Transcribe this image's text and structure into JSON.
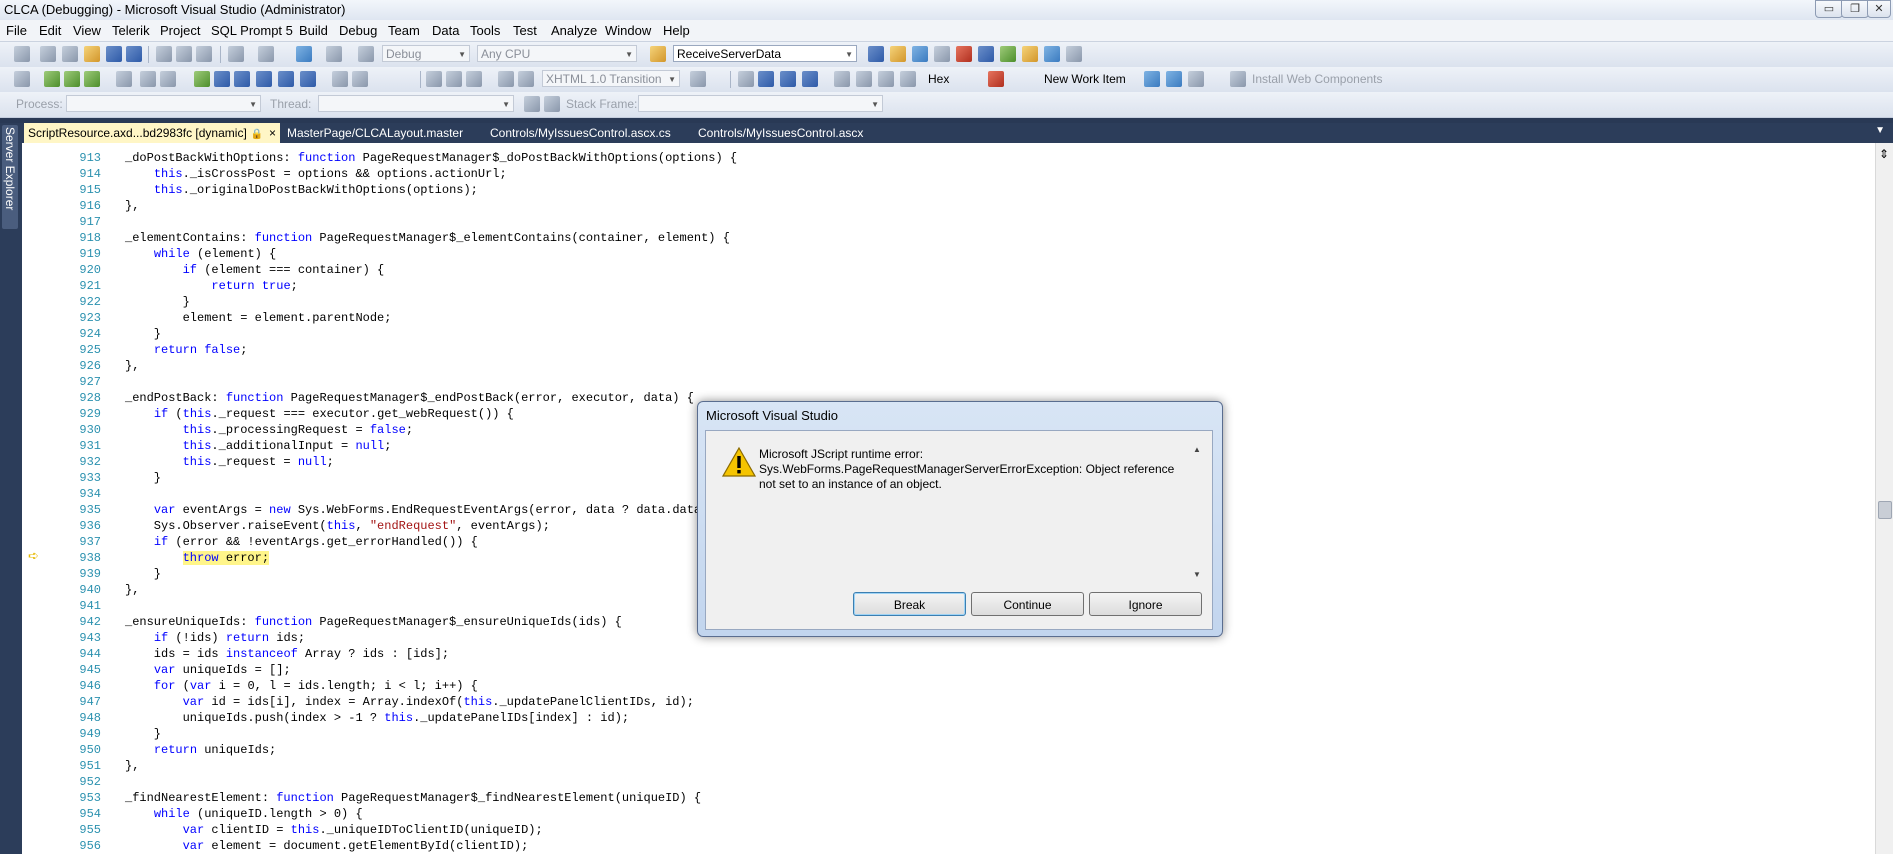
{
  "window": {
    "title": "CLCA (Debugging) - Microsoft Visual Studio (Administrator)",
    "min_glyph": "▭",
    "restore_glyph": "❐",
    "close_glyph": "✕"
  },
  "menu": [
    "File",
    "Edit",
    "View",
    "Telerik",
    "Project",
    "SQL Prompt 5",
    "Build",
    "Debug",
    "Team",
    "Data",
    "Tools",
    "Test",
    "Analyze",
    "Window",
    "Help"
  ],
  "toolbar1": {
    "config": "Debug",
    "platform": "Any CPU",
    "find_value": "ReceiveServerData"
  },
  "toolbar2": {
    "doc_schema": "XHTML 1.0 Transition",
    "hex_label": "Hex",
    "new_work_item": "New Work Item",
    "install_web_components": "Install Web Components"
  },
  "toolbar3": {
    "process_label": "Process:",
    "thread_label": "Thread:",
    "stack_frame_label": "Stack Frame:"
  },
  "tabs": [
    {
      "label": "ScriptResource.axd...bd2983fc [dynamic]",
      "active": true
    },
    {
      "label": "MasterPage/CLCALayout.master"
    },
    {
      "label": "Controls/MyIssuesControl.ascx.cs"
    },
    {
      "label": "Controls/MyIssuesControl.ascx"
    }
  ],
  "tab_close_glyph": "×",
  "tab_pin_glyph": "🔒",
  "side_panel": {
    "label": "Server Explorer"
  },
  "code": {
    "current_line_index": 25,
    "lines": [
      {
        "n": "913",
        "t": "_doPostBackWithOptions: function PageRequestManager$_doPostBackWithOptions(options) {"
      },
      {
        "n": "914",
        "t": "    this._isCrossPost = options && options.actionUrl;"
      },
      {
        "n": "915",
        "t": "    this._originalDoPostBackWithOptions(options);"
      },
      {
        "n": "916",
        "t": "},"
      },
      {
        "n": "917",
        "t": ""
      },
      {
        "n": "918",
        "t": "_elementContains: function PageRequestManager$_elementContains(container, element) {"
      },
      {
        "n": "919",
        "t": "    while (element) {"
      },
      {
        "n": "920",
        "t": "        if (element === container) {"
      },
      {
        "n": "921",
        "t": "            return true;"
      },
      {
        "n": "922",
        "t": "        }"
      },
      {
        "n": "923",
        "t": "        element = element.parentNode;"
      },
      {
        "n": "924",
        "t": "    }"
      },
      {
        "n": "925",
        "t": "    return false;"
      },
      {
        "n": "926",
        "t": "},"
      },
      {
        "n": "927",
        "t": ""
      },
      {
        "n": "928",
        "t": "_endPostBack: function PageRequestManager$_endPostBack(error, executor, data) {"
      },
      {
        "n": "929",
        "t": "    if (this._request === executor.get_webRequest()) {"
      },
      {
        "n": "930",
        "t": "        this._processingRequest = false;"
      },
      {
        "n": "931",
        "t": "        this._additionalInput = null;"
      },
      {
        "n": "932",
        "t": "        this._request = null;"
      },
      {
        "n": "933",
        "t": "    }"
      },
      {
        "n": "934",
        "t": ""
      },
      {
        "n": "935",
        "t": "    var eventArgs = new Sys.WebForms.EndRequestEventArgs(error, data ? data.dataI"
      },
      {
        "n": "936",
        "t": "    Sys.Observer.raiseEvent(this, \"endRequest\", eventArgs);"
      },
      {
        "n": "937",
        "t": "    if (error && !eventArgs.get_errorHandled()) {"
      },
      {
        "n": "938",
        "t": "        throw error;"
      },
      {
        "n": "939",
        "t": "    }"
      },
      {
        "n": "940",
        "t": "},"
      },
      {
        "n": "941",
        "t": ""
      },
      {
        "n": "942",
        "t": "_ensureUniqueIds: function PageRequestManager$_ensureUniqueIds(ids) {"
      },
      {
        "n": "943",
        "t": "    if (!ids) return ids;"
      },
      {
        "n": "944",
        "t": "    ids = ids instanceof Array ? ids : [ids];"
      },
      {
        "n": "945",
        "t": "    var uniqueIds = [];"
      },
      {
        "n": "946",
        "t": "    for (var i = 0, l = ids.length; i < l; i++) {"
      },
      {
        "n": "947",
        "t": "        var id = ids[i], index = Array.indexOf(this._updatePanelClientIDs, id);"
      },
      {
        "n": "948",
        "t": "        uniqueIds.push(index > -1 ? this._updatePanelIDs[index] : id);"
      },
      {
        "n": "949",
        "t": "    }"
      },
      {
        "n": "950",
        "t": "    return uniqueIds;"
      },
      {
        "n": "951",
        "t": "},"
      },
      {
        "n": "952",
        "t": ""
      },
      {
        "n": "953",
        "t": "_findNearestElement: function PageRequestManager$_findNearestElement(uniqueID) {"
      },
      {
        "n": "954",
        "t": "    while (uniqueID.length > 0) {"
      },
      {
        "n": "955",
        "t": "        var clientID = this._uniqueIDToClientID(uniqueID);"
      },
      {
        "n": "956",
        "t": "        var element = document.getElementById(clientID);"
      }
    ]
  },
  "dialog": {
    "title": "Microsoft Visual Studio",
    "message_line1": "Microsoft JScript runtime error:",
    "message_line2": "Sys.WebForms.PageRequestManagerServerErrorException: Object reference not set to an instance of an object.",
    "buttons": {
      "break": "Break",
      "continue": "Continue",
      "ignore": "Ignore"
    }
  },
  "colors": {
    "keyword": "#0000ff",
    "string": "#a31515",
    "line_number": "#2b91af",
    "current_statement": "#fff58a",
    "chrome_dark": "#2c3d5a"
  }
}
